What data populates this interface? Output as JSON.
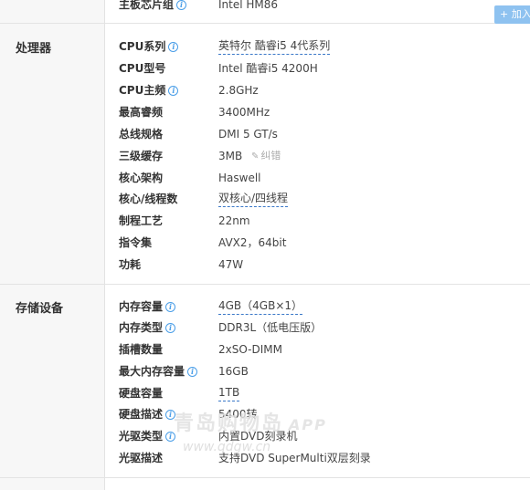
{
  "top_row": {
    "label": "主板芯片组",
    "value": "Intel HM86",
    "add_label": "+ 加入"
  },
  "sections": {
    "processor": {
      "title": "处理器",
      "rows": [
        {
          "label": "CPU系列",
          "value": "英特尔 酷睿i5 4代系列",
          "info": true,
          "link": true
        },
        {
          "label": "CPU型号",
          "value": "Intel 酷睿i5 4200H"
        },
        {
          "label": "CPU主频",
          "value": "2.8GHz",
          "info": true
        },
        {
          "label": "最高睿频",
          "value": "3400MHz"
        },
        {
          "label": "总线规格",
          "value": "DMI 5 GT/s"
        },
        {
          "label": "三级缓存",
          "value": "3MB",
          "edit": "纠错"
        },
        {
          "label": "核心架构",
          "value": "Haswell"
        },
        {
          "label": "核心/线程数",
          "value": "双核心/四线程",
          "link": true
        },
        {
          "label": "制程工艺",
          "value": "22nm"
        },
        {
          "label": "指令集",
          "value": "AVX2，64bit"
        },
        {
          "label": "功耗",
          "value": "47W"
        }
      ]
    },
    "storage": {
      "title": "存储设备",
      "rows": [
        {
          "label": "内存容量",
          "value": "4GB（4GB×1）",
          "info": true,
          "link": true
        },
        {
          "label": "内存类型",
          "value": "DDR3L（低电压版）",
          "info": true
        },
        {
          "label": "插槽数量",
          "value": "2xSO-DIMM"
        },
        {
          "label": "最大内存容量",
          "value": "16GB",
          "info": true
        },
        {
          "label": "硬盘容量",
          "value": "1TB",
          "link": true
        },
        {
          "label": "硬盘描述",
          "value": "5400转",
          "info": true
        },
        {
          "label": "光驱类型",
          "value": "内置DVD刻录机",
          "info": true
        },
        {
          "label": "光驱描述",
          "value": "支持DVD SuperMulti双层刻录"
        }
      ]
    }
  },
  "watermark": {
    "text": "青岛购物岛",
    "app": "APP",
    "url": "www.qdgw.cn"
  },
  "colors": {
    "link_underline": "#3a78c8",
    "info_icon": "#4a9ee8",
    "add_button": "#8ec2f0"
  }
}
